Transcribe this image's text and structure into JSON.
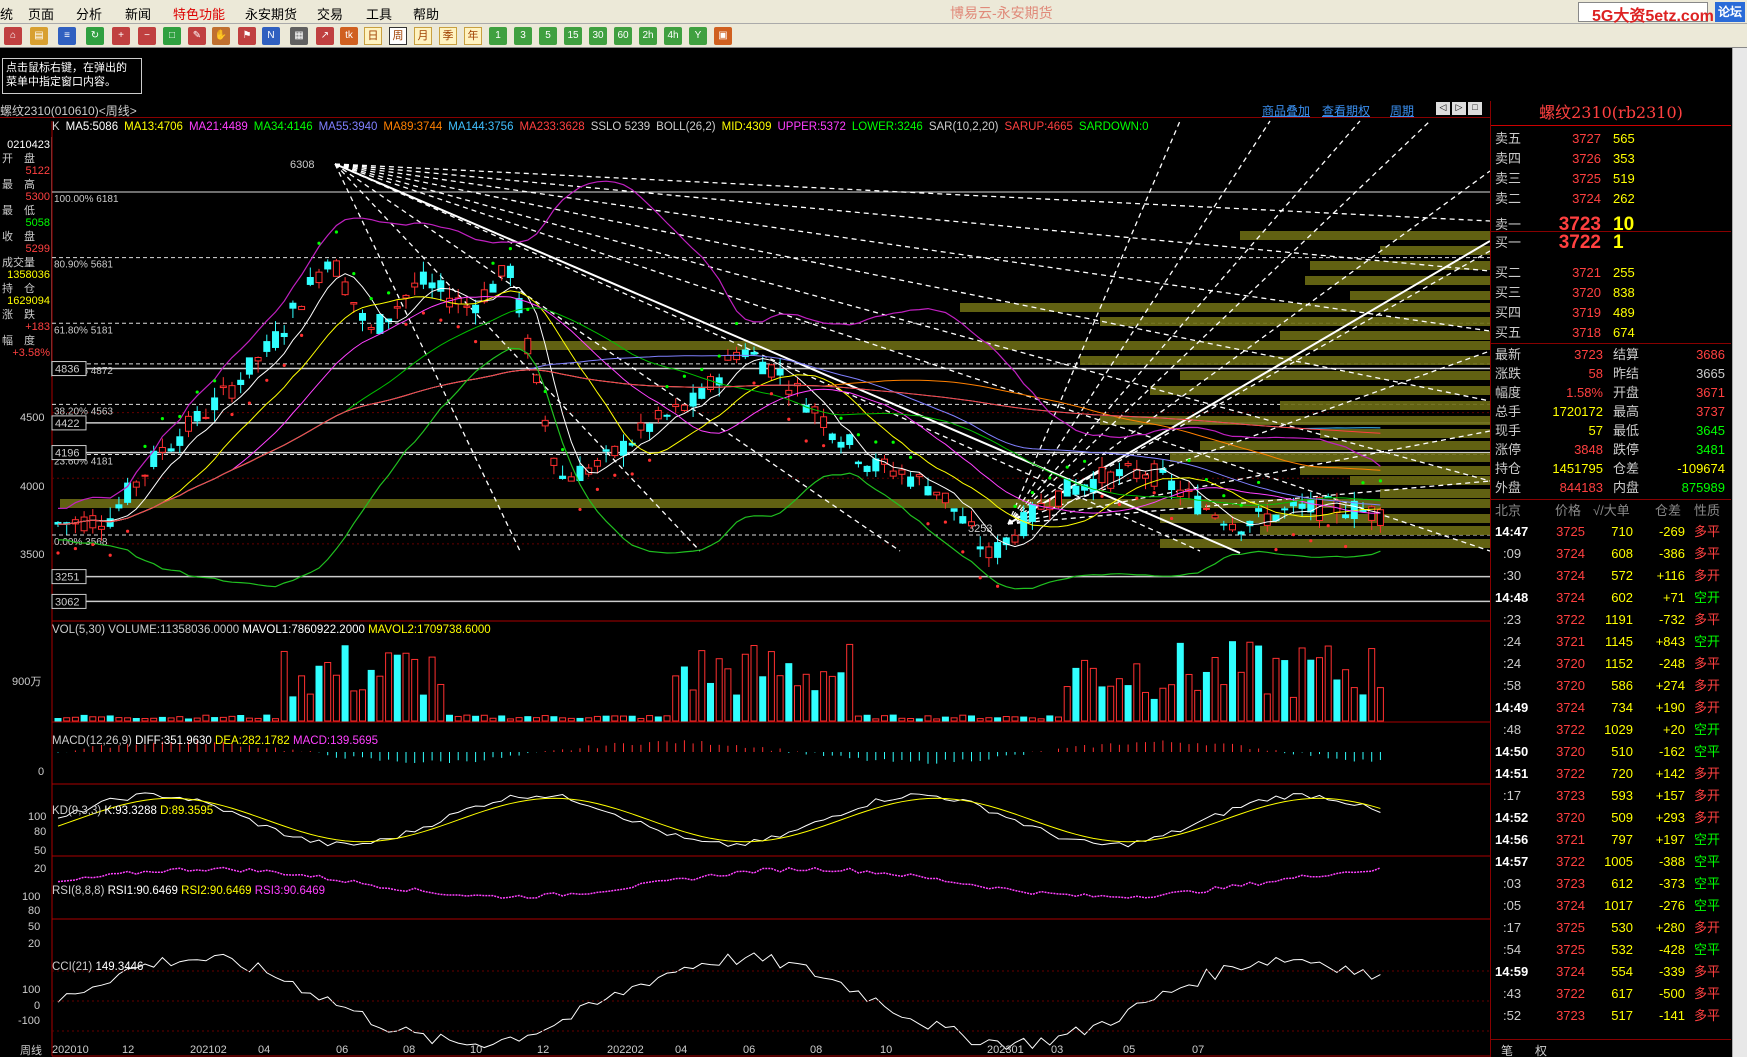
{
  "menubar": {
    "items": [
      "页面",
      "分析",
      "新闻",
      "特色功能",
      "永安期货",
      "交易",
      "工具",
      "帮助"
    ],
    "first_char": "统",
    "active_item": "特色功能",
    "app_title": "博易云-永安期货",
    "watermark": "5G大资5etz.com",
    "close_label": "论坛"
  },
  "toolbar": {
    "period_buttons": [
      "周",
      "月",
      "季",
      "年"
    ],
    "minute_buttons": [
      "1",
      "3",
      "5",
      "15",
      "30",
      "60",
      "2h",
      "4h",
      "Y"
    ],
    "day_button": "日",
    "selected": "周"
  },
  "tip": {
    "line1": "点击鼠标右键，在弹出的",
    "line2": "菜单中指定窗口内容。"
  },
  "chart_header": {
    "contract": "螺纹2310(010610)<周线>",
    "links": [
      "商品叠加",
      "查看期权",
      "周期"
    ]
  },
  "ma_line": [
    {
      "text": "K",
      "color": "#cccccc"
    },
    {
      "text": "MA5:5086",
      "color": "#ffffff"
    },
    {
      "text": "MA13:4706",
      "color": "#ffff00"
    },
    {
      "text": "MA21:4489",
      "color": "#ff40ff"
    },
    {
      "text": "MA34:4146",
      "color": "#00ff00"
    },
    {
      "text": "MA55:3940",
      "color": "#8080ff"
    },
    {
      "text": "MA89:3744",
      "color": "#ff8000"
    },
    {
      "text": "MA144:3756",
      "color": "#40c0ff"
    },
    {
      "text": "MA233:3628",
      "color": "#ff4040"
    },
    {
      "text": "SSLO 5239",
      "color": "#cccccc"
    },
    {
      "text": "BOLL(26,2)",
      "color": "#cccccc"
    },
    {
      "text": "MID:4309",
      "color": "#ffff00"
    },
    {
      "text": "UPPER:5372",
      "color": "#ff40ff"
    },
    {
      "text": "LOWER:3246",
      "color": "#00ff00"
    },
    {
      "text": "SAR(10,2,20)",
      "color": "#cccccc"
    },
    {
      "text": "SARUP:4665",
      "color": "#ff4040"
    },
    {
      "text": "SARDOWN:0",
      "color": "#00ff00"
    }
  ],
  "left_info": {
    "date": "0210423",
    "open_label": "开　盘",
    "open": "5122",
    "high_label": "最　高",
    "high": "5300",
    "low_label": "最　低",
    "low": "5058",
    "close_label": "收　盘",
    "close": "5299",
    "vol_label": "成交量",
    "vol": "1358036",
    "oi_label": "持　仓",
    "oi": "1629094",
    "chg_label": "涨　跌",
    "chg": "+183",
    "pct_label": "幅　度",
    "pct": "+3.58%"
  },
  "price_axis": [
    "4500",
    "4000",
    "3500"
  ],
  "price_boxes": [
    "4836",
    "4422",
    "4196",
    "3251",
    "3062"
  ],
  "fib_labels": [
    "100.00% 6181",
    "80.90% 5681",
    "61.80% 5181",
    "50.00% 4872",
    "38.20% 4563",
    "23.60% 4181",
    "0.00% 3568"
  ],
  "peak_label": "6308",
  "trough_label": "3253",
  "vol_panel": {
    "title": "VOL(5,30)",
    "v1": "VOLUME:11358036.0000",
    "v2": "MAVOL1:7860922.2000",
    "v3": "MAVOL2:1709738.6000",
    "axis": "900万"
  },
  "macd_panel": {
    "title": "MACD(12,26,9)",
    "v1": "DIFF:351.9630",
    "v2": "DEA:282.1782",
    "v3": "MACD:139.5695",
    "axis": "0"
  },
  "kd_panel": {
    "title": "KD(9,3,3)",
    "v1": "K:93.3288",
    "v2": "D:89.3595",
    "axis": [
      "100",
      "80",
      "50",
      "20"
    ]
  },
  "rsi_panel": {
    "title": "RSI(8,8,8)",
    "v1": "RSI1:90.6469",
    "v2": "RSI2:90.6469",
    "v3": "RSI3:90.6469",
    "axis": [
      "100",
      "80",
      "50",
      "20"
    ]
  },
  "cci_panel": {
    "title": "CCI(21)",
    "v1": "149.3446",
    "axis": [
      "100",
      "0",
      "-100"
    ]
  },
  "x_axis": {
    "period": "周线",
    "labels": [
      "202010",
      "12",
      "202102",
      "04",
      "06",
      "08",
      "10",
      "12",
      "202202",
      "04",
      "06",
      "08",
      "10",
      "202301",
      "03",
      "05",
      "07"
    ]
  },
  "right_panel": {
    "title": "螺纹2310(rb2310)",
    "asks": [
      {
        "label": "卖五",
        "price": "3727",
        "vol": "565"
      },
      {
        "label": "卖四",
        "price": "3726",
        "vol": "353"
      },
      {
        "label": "卖三",
        "price": "3725",
        "vol": "519"
      },
      {
        "label": "卖二",
        "price": "3724",
        "vol": "262"
      },
      {
        "label": "卖一",
        "price": "3723",
        "vol": "10"
      }
    ],
    "bids": [
      {
        "label": "买一",
        "price": "3722",
        "vol": "1"
      },
      {
        "label": "买二",
        "price": "3721",
        "vol": "255"
      },
      {
        "label": "买三",
        "price": "3720",
        "vol": "838"
      },
      {
        "label": "买四",
        "price": "3719",
        "vol": "489"
      },
      {
        "label": "买五",
        "price": "3718",
        "vol": "674"
      }
    ],
    "stats": [
      {
        "l1": "最新",
        "v1": "3723",
        "l2": "结算",
        "v2": "3686",
        "c1": "#ff4040",
        "c2": "#ff4040"
      },
      {
        "l1": "涨跌",
        "v1": "58",
        "l2": "昨结",
        "v2": "3665",
        "c1": "#ff4040",
        "c2": "#cccccc"
      },
      {
        "l1": "幅度",
        "v1": "1.58%",
        "l2": "开盘",
        "v2": "3671",
        "c1": "#ff4040",
        "c2": "#ff4040"
      },
      {
        "l1": "总手",
        "v1": "1720172",
        "l2": "最高",
        "v2": "3737",
        "c1": "#ffff00",
        "c2": "#ff4040"
      },
      {
        "l1": "现手",
        "v1": "57",
        "l2": "最低",
        "v2": "3645",
        "c1": "#ffff00",
        "c2": "#00ff00"
      },
      {
        "l1": "涨停",
        "v1": "3848",
        "l2": "跌停",
        "v2": "3481",
        "c1": "#ff4040",
        "c2": "#00ff00"
      },
      {
        "l1": "持仓",
        "v1": "1451795",
        "l2": "仓差",
        "v2": "-109674",
        "c1": "#ffff00",
        "c2": "#ffff00"
      },
      {
        "l1": "外盘",
        "v1": "844183",
        "l2": "内盘",
        "v2": "875989",
        "c1": "#ff4040",
        "c2": "#00ff00"
      }
    ],
    "ticks_header": {
      "loc": "北京",
      "price": "价格",
      "vol": "√/大单",
      "oi": "仓差",
      "nature": "性质"
    },
    "ticks": [
      {
        "t": "14:47",
        "p": "3725",
        "v": "710",
        "oi": "-269",
        "n": "多平",
        "pc": "#ff4040",
        "nc": "#ff4040",
        "tb": true
      },
      {
        "t": ":09",
        "p": "3724",
        "v": "608",
        "oi": "-386",
        "n": "多平",
        "pc": "#ff4040",
        "nc": "#ff4040",
        "tb": false
      },
      {
        "t": ":30",
        "p": "3724",
        "v": "572",
        "oi": "+116",
        "n": "多开",
        "pc": "#ff4040",
        "nc": "#ff4040",
        "tb": false
      },
      {
        "t": "14:48",
        "p": "3724",
        "v": "602",
        "oi": "+71",
        "n": "空开",
        "pc": "#ff4040",
        "nc": "#00ff00",
        "tb": true
      },
      {
        "t": ":23",
        "p": "3722",
        "v": "1191",
        "oi": "-732",
        "n": "多平",
        "pc": "#ff4040",
        "nc": "#ff4040",
        "tb": false
      },
      {
        "t": ":24",
        "p": "3721",
        "v": "1145",
        "oi": "+843",
        "n": "空开",
        "pc": "#ff4040",
        "nc": "#00ff00",
        "tb": false
      },
      {
        "t": ":24",
        "p": "3720",
        "v": "1152",
        "oi": "-248",
        "n": "多平",
        "pc": "#ff4040",
        "nc": "#ff4040",
        "tb": false
      },
      {
        "t": ":58",
        "p": "3720",
        "v": "586",
        "oi": "+274",
        "n": "多开",
        "pc": "#ff4040",
        "nc": "#ff4040",
        "tb": false
      },
      {
        "t": "14:49",
        "p": "3724",
        "v": "734",
        "oi": "+190",
        "n": "多开",
        "pc": "#ff4040",
        "nc": "#ff4040",
        "tb": true
      },
      {
        "t": ":48",
        "p": "3722",
        "v": "1029",
        "oi": "+20",
        "n": "空开",
        "pc": "#ff4040",
        "nc": "#00ff00",
        "tb": false
      },
      {
        "t": "14:50",
        "p": "3720",
        "v": "510",
        "oi": "-162",
        "n": "空平",
        "pc": "#ff4040",
        "nc": "#00ff00",
        "tb": true
      },
      {
        "t": "14:51",
        "p": "3722",
        "v": "720",
        "oi": "+142",
        "n": "多开",
        "pc": "#ff4040",
        "nc": "#ff4040",
        "tb": true
      },
      {
        "t": ":17",
        "p": "3723",
        "v": "593",
        "oi": "+157",
        "n": "多开",
        "pc": "#ff4040",
        "nc": "#ff4040",
        "tb": false
      },
      {
        "t": "14:52",
        "p": "3720",
        "v": "509",
        "oi": "+293",
        "n": "多开",
        "pc": "#ff4040",
        "nc": "#ff4040",
        "tb": true
      },
      {
        "t": "14:56",
        "p": "3721",
        "v": "797",
        "oi": "+197",
        "n": "空开",
        "pc": "#ff4040",
        "nc": "#00ff00",
        "tb": true
      },
      {
        "t": "14:57",
        "p": "3722",
        "v": "1005",
        "oi": "-388",
        "n": "空平",
        "pc": "#ff4040",
        "nc": "#00ff00",
        "tb": true
      },
      {
        "t": ":03",
        "p": "3723",
        "v": "612",
        "oi": "-373",
        "n": "空平",
        "pc": "#ff4040",
        "nc": "#00ff00",
        "tb": false
      },
      {
        "t": ":05",
        "p": "3724",
        "v": "1017",
        "oi": "-276",
        "n": "空平",
        "pc": "#ff4040",
        "nc": "#00ff00",
        "tb": false
      },
      {
        "t": ":17",
        "p": "3725",
        "v": "530",
        "oi": "+280",
        "n": "多开",
        "pc": "#ff4040",
        "nc": "#ff4040",
        "tb": false
      },
      {
        "t": ":54",
        "p": "3725",
        "v": "532",
        "oi": "-428",
        "n": "空平",
        "pc": "#ff4040",
        "nc": "#00ff00",
        "tb": false
      },
      {
        "t": "14:59",
        "p": "3724",
        "v": "554",
        "oi": "-339",
        "n": "多平",
        "pc": "#ff4040",
        "nc": "#ff4040",
        "tb": true
      },
      {
        "t": ":43",
        "p": "3722",
        "v": "617",
        "oi": "-500",
        "n": "多平",
        "pc": "#ff4040",
        "nc": "#ff4040",
        "tb": false
      },
      {
        "t": ":52",
        "p": "3723",
        "v": "517",
        "oi": "-141",
        "n": "多平",
        "pc": "#ff4040",
        "nc": "#ff4040",
        "tb": false
      }
    ],
    "bottom_tabs": [
      "笔",
      "权"
    ]
  }
}
